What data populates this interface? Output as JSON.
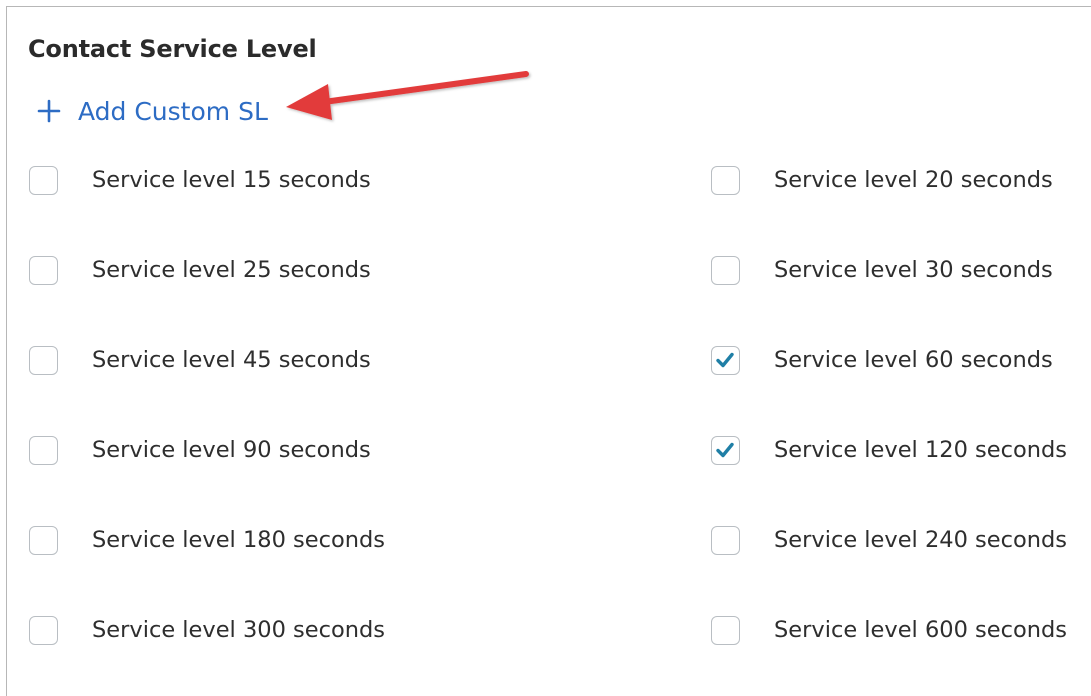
{
  "section": {
    "title": "Contact Service Level",
    "add_custom_label": "Add Custom SL"
  },
  "options": {
    "left": [
      {
        "label": "Service level 15 seconds",
        "checked": false
      },
      {
        "label": "Service level 25 seconds",
        "checked": false
      },
      {
        "label": "Service level 45 seconds",
        "checked": false
      },
      {
        "label": "Service level 90 seconds",
        "checked": false
      },
      {
        "label": "Service level 180 seconds",
        "checked": false
      },
      {
        "label": "Service level 300 seconds",
        "checked": false
      }
    ],
    "right": [
      {
        "label": "Service level 20 seconds",
        "checked": false
      },
      {
        "label": "Service level 30 seconds",
        "checked": false
      },
      {
        "label": "Service level 60 seconds",
        "checked": true
      },
      {
        "label": "Service level 120 seconds",
        "checked": true
      },
      {
        "label": "Service level 240 seconds",
        "checked": false
      },
      {
        "label": "Service level 600 seconds",
        "checked": false
      }
    ]
  },
  "colors": {
    "link": "#2d6cc4",
    "check": "#1f7fa6",
    "annotation_arrow": "#e23b3b"
  },
  "icons": {
    "add": "plus-icon",
    "checked": "checkmark-icon",
    "annotation": "red-arrow"
  }
}
